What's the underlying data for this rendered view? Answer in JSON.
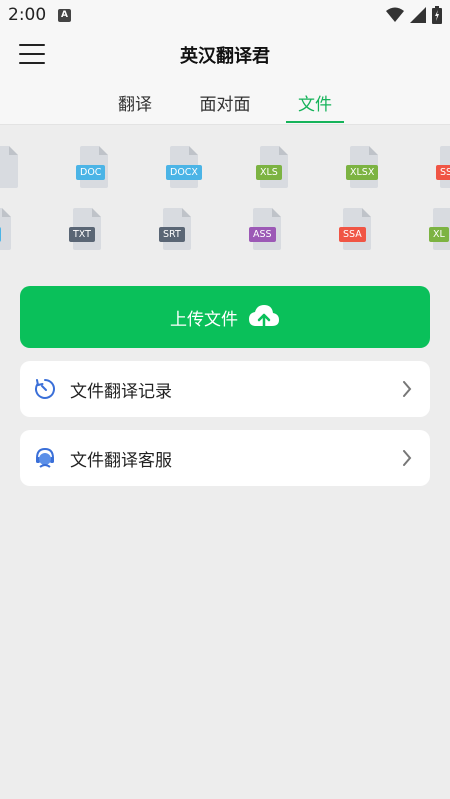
{
  "status_bar": {
    "time": "2:00",
    "notification_icon": "A"
  },
  "app_bar": {
    "title": "英汉翻译君",
    "menu_icon": "hamburger-menu-icon"
  },
  "tabs": [
    {
      "label": "翻译",
      "active": false
    },
    {
      "label": "面对面",
      "active": false
    },
    {
      "label": "文件",
      "active": true
    }
  ],
  "colors": {
    "accent": "#16b35a",
    "upload_button": "#0ac05a",
    "gray_badge": "#5a6675",
    "blue_badge": "#4bb4e6",
    "green_badge": "#7cb342",
    "red_badge": "#f05545",
    "purple_badge": "#9c59b6"
  },
  "file_formats_row1": [
    {
      "label": "",
      "color": "#5a6675"
    },
    {
      "label": "DOC",
      "color": "#4bb4e6"
    },
    {
      "label": "DOCX",
      "color": "#4bb4e6"
    },
    {
      "label": "XLS",
      "color": "#7cb342"
    },
    {
      "label": "XLSX",
      "color": "#7cb342"
    },
    {
      "label": "SSA",
      "color": "#f05545"
    }
  ],
  "file_formats_row2": [
    {
      "label": "OC",
      "color": "#4bb4e6"
    },
    {
      "label": "TXT",
      "color": "#5a6675"
    },
    {
      "label": "SRT",
      "color": "#5a6675"
    },
    {
      "label": "ASS",
      "color": "#9c59b6"
    },
    {
      "label": "SSA",
      "color": "#f05545"
    },
    {
      "label": "XL",
      "color": "#7cb342"
    }
  ],
  "upload": {
    "label": "上传文件",
    "icon": "cloud-upload-icon"
  },
  "cards": [
    {
      "label": "文件翻译记录",
      "icon": "timer-icon"
    },
    {
      "label": "文件翻译客服",
      "icon": "customer-service-icon"
    }
  ]
}
